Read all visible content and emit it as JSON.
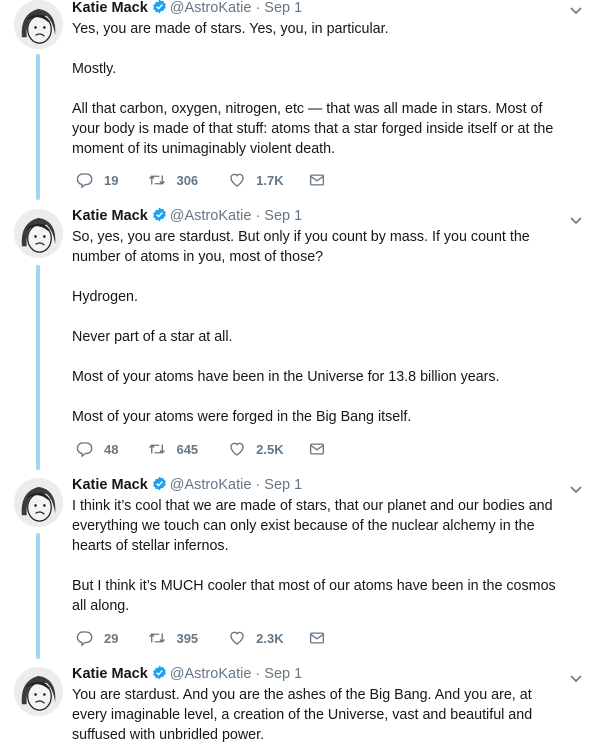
{
  "tweets": [
    {
      "name": "Katie Mack",
      "handle": "@AstroKatie",
      "separator": "·",
      "date": "Sep 1",
      "paragraphs": [
        "Yes, you are made of stars. Yes, you, in particular.",
        "Mostly.",
        "All that carbon, oxygen, nitrogen, etc — that was all made in stars. Most of your body is made of that stuff: atoms that a star forged inside itself or at the moment of its unimaginably violent death."
      ],
      "replies": "19",
      "retweets": "306",
      "likes": "1.7K"
    },
    {
      "name": "Katie Mack",
      "handle": "@AstroKatie",
      "separator": "·",
      "date": "Sep 1",
      "paragraphs": [
        "So, yes, you are stardust. But only if you count by mass. If you count the number of atoms in you, most of those?",
        "Hydrogen.",
        "Never part of a star at all.",
        "Most of your atoms have been in the Universe for 13.8 billion years.",
        "Most of your atoms were forged in the Big Bang itself."
      ],
      "replies": "48",
      "retweets": "645",
      "likes": "2.5K"
    },
    {
      "name": "Katie Mack",
      "handle": "@AstroKatie",
      "separator": "·",
      "date": "Sep 1",
      "paragraphs": [
        "I think it’s cool that we are made of stars, that our planet and our bodies and everything we touch can only exist because of the nuclear alchemy in the hearts of stellar infernos.",
        "But I think it’s MUCH cooler that most of our atoms have been in the cosmos all along."
      ],
      "replies": "29",
      "retweets": "395",
      "likes": "2.3K"
    },
    {
      "name": "Katie Mack",
      "handle": "@AstroKatie",
      "separator": "·",
      "date": "Sep 1",
      "paragraphs": [
        "You are stardust. And you are the ashes of the Big Bang. And you are, at every imaginable level, a creation of the Universe, vast and beautiful and suffused with unbridled power."
      ]
    }
  ],
  "icons": {
    "reply": "reply-icon",
    "retweet": "retweet-icon",
    "like": "heart-icon",
    "message": "envelope-icon",
    "verified": "verified-badge-icon",
    "more": "chevron-down-icon"
  },
  "colors": {
    "thread_line": "#9fd6f3",
    "verified": "#1da1f2",
    "muted": "#657786",
    "text": "#14171a"
  }
}
